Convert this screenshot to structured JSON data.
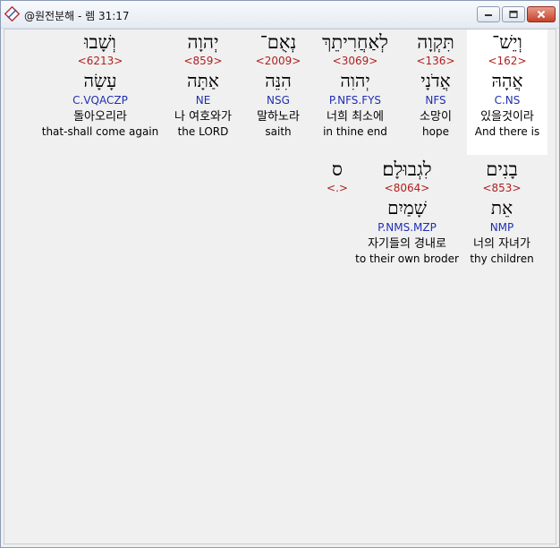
{
  "window": {
    "title": "@원전분해 - 렘 31:17",
    "minimize_label": "minimize",
    "maximize_label": "maximize",
    "close_label": "close"
  },
  "row1": [
    {
      "hebrew": "וְיֵשׁ־",
      "strongs": "<162>",
      "root": "אֲהָהּ",
      "parse": "C.NS",
      "korean": "있을것이라",
      "english": "And there is",
      "selected": true
    },
    {
      "hebrew": "תִּקְוָה",
      "strongs": "<136>",
      "root": "אֲדֹנָי",
      "parse": "NFS",
      "korean": "소망이",
      "english": "hope",
      "selected": false
    },
    {
      "hebrew": "לְאַחֲרִיתֵךְ",
      "strongs": "<3069>",
      "root": "יְהוִה",
      "parse": "P.NFS.FYS",
      "korean": "너희 최소에",
      "english": "in thine end",
      "selected": false
    },
    {
      "hebrew": "נְאֻם־",
      "strongs": "<2009>",
      "root": "הִנֵּה",
      "parse": "NSG",
      "korean": "말하노라",
      "english": "saith",
      "selected": false
    },
    {
      "hebrew": "יְהוָה",
      "strongs": "<859>",
      "root": "אַתָּה",
      "parse": "NE",
      "korean": "나 여호와가",
      "english": "the LORD",
      "selected": false
    },
    {
      "hebrew": "וְשָׁבוּ",
      "strongs": "<6213>",
      "root": "עָשָׂה",
      "parse": "C.VQACZP",
      "korean": "돌아오리라",
      "english": "that-shall come again",
      "selected": false
    }
  ],
  "row2": [
    {
      "hebrew": "בָנִים",
      "strongs": "<853>",
      "root": "אֵת",
      "parse": "NMP",
      "korean": "너의 자녀가",
      "english": "thy children"
    },
    {
      "hebrew": "לִגְבוּלָם׃",
      "strongs": "<8064>",
      "root": "שָׁמַיִם",
      "parse": "P.NMS.MZP",
      "korean": "자기들의 경내로",
      "english": "to their own broder"
    },
    {
      "hebrew": "ס",
      "strongs": "<.>",
      "root": "",
      "parse": "",
      "korean": "",
      "english": ""
    }
  ]
}
